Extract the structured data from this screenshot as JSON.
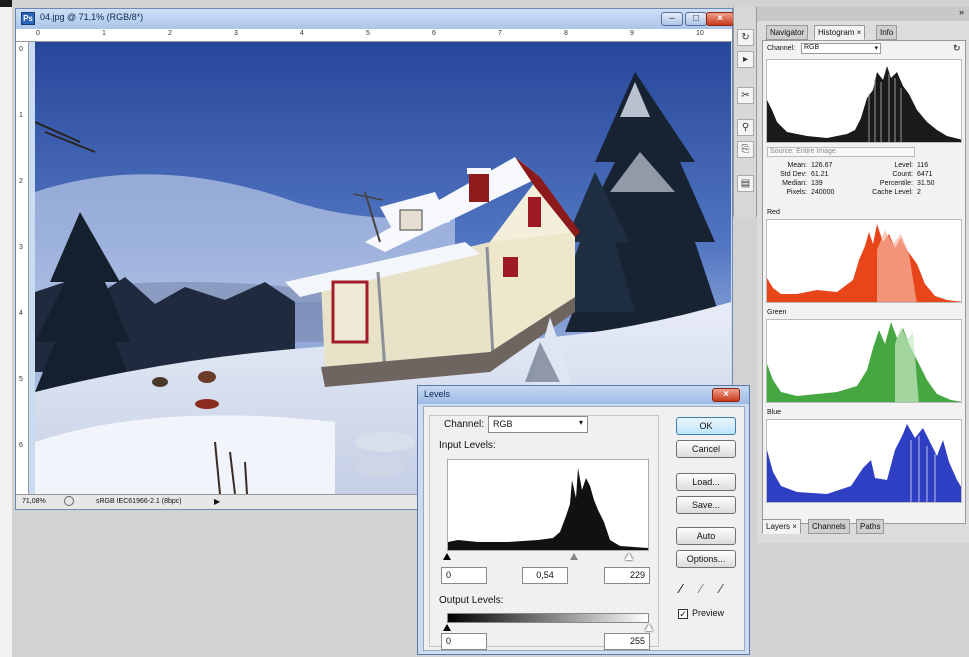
{
  "document": {
    "title": "04.jpg @ 71,1% (RGB/8*)",
    "zoom": "71,08%",
    "profile": "sRGB IEC61966-2.1 (8bpc)",
    "ruler_marks": [
      "0",
      "1",
      "2",
      "3",
      "4",
      "5",
      "6",
      "7",
      "8",
      "9",
      "10"
    ],
    "ruler_v_marks": [
      "0",
      "1",
      "2",
      "3",
      "4",
      "5",
      "6"
    ]
  },
  "levels": {
    "title": "Levels",
    "channel_label": "Channel:",
    "channel_value": "RGB",
    "input_levels_label": "Input Levels:",
    "input_black": "0",
    "input_gamma": "0,54",
    "input_white": "229",
    "output_levels_label": "Output Levels:",
    "output_black": "0",
    "output_white": "255",
    "buttons": {
      "ok": "OK",
      "cancel": "Cancel",
      "load": "Load...",
      "save": "Save...",
      "auto": "Auto",
      "options": "Options..."
    },
    "preview_label": "Preview",
    "preview_checked": true
  },
  "panels": {
    "tabs": [
      "Navigator",
      "Histogram ×",
      "Info"
    ],
    "channel_label": "Channel:",
    "channel_value": "RGB",
    "source_label": "Source:",
    "source_value": "Entire Image",
    "stats": {
      "mean_label": "Mean:",
      "mean": "126.67",
      "stddev_label": "Std Dev:",
      "stddev": "61.21",
      "median_label": "Median:",
      "median": "139",
      "pixels_label": "Pixels:",
      "pixels": "240000",
      "level_label": "Level:",
      "level": "116",
      "count_label": "Count:",
      "count": "6471",
      "percentile_label": "Percentile:",
      "percentile": "31.50",
      "cache_label": "Cache Level:",
      "cache": "2"
    },
    "red_label": "Red",
    "green_label": "Green",
    "blue_label": "Blue",
    "layers_tabs": [
      "Layers ×",
      "Channels",
      "Paths"
    ]
  },
  "colors": {
    "red_channel": "#e83a12",
    "green_channel": "#3fa63a",
    "blue_channel": "#2c3fbf",
    "sky_top": "#2f4f9e",
    "sky_bottom": "#c4d2ea"
  }
}
